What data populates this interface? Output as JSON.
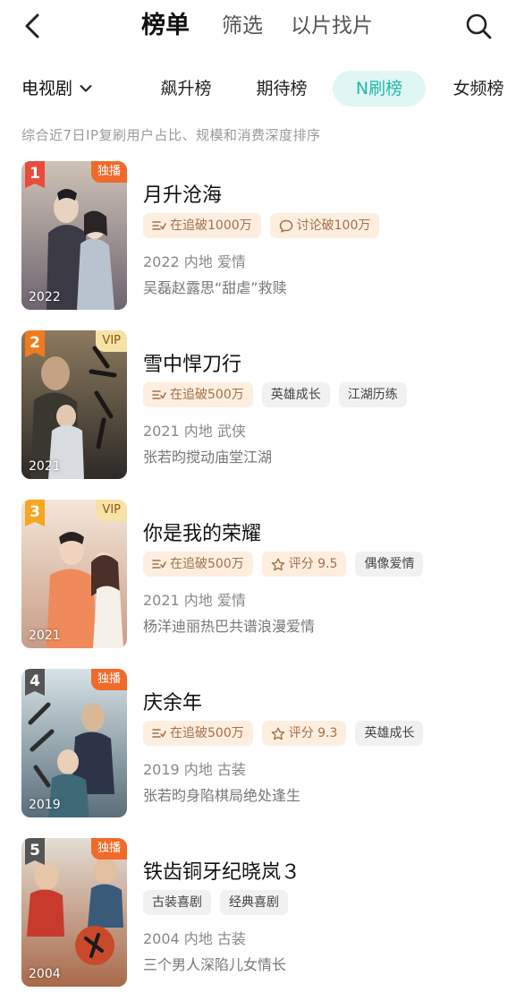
{
  "header": {
    "tabs": [
      {
        "label": "榜单",
        "active": true
      },
      {
        "label": "筛选",
        "active": false
      },
      {
        "label": "以片找片",
        "active": false
      }
    ]
  },
  "filter": {
    "genre": "电视剧",
    "subtabs": [
      {
        "label": "飙升榜",
        "active": false
      },
      {
        "label": "期待榜",
        "active": false
      },
      {
        "label": "N刷榜",
        "active": true
      },
      {
        "label": "女频榜",
        "active": false
      }
    ]
  },
  "description": "综合近7日IP复刷用户占比、规模和消费深度排序",
  "colors": {
    "accent": "#23b7ac",
    "accent_bg": "#dff6f4",
    "rank1": "#e94b3c",
    "rank2": "#f07b1f",
    "rank3": "#f5a623",
    "rank_other": "#555555",
    "exclusive": "#f06a2a",
    "vip": "#f6e2a6"
  },
  "items": [
    {
      "rank": "1",
      "corner": "独播",
      "corner_type": "exclusive",
      "year": "2022",
      "title": "月升沧海",
      "chips": [
        {
          "text": "在追破1000万",
          "type": "hot",
          "icon": "follow-icon"
        },
        {
          "text": "讨论破100万",
          "type": "hot",
          "icon": "comment-icon"
        }
      ],
      "meta": "2022 内地 爱情",
      "line2": "吴磊赵露思“甜虐”救赎"
    },
    {
      "rank": "2",
      "corner": "VIP",
      "corner_type": "vip",
      "year": "2021",
      "title": "雪中悍刀行",
      "chips": [
        {
          "text": "在追破500万",
          "type": "hot",
          "icon": "follow-icon"
        },
        {
          "text": "英雄成长",
          "type": "plain",
          "icon": ""
        },
        {
          "text": "江湖历练",
          "type": "plain",
          "icon": ""
        }
      ],
      "meta": "2021 内地 武侠",
      "line2": "张若昀搅动庙堂江湖"
    },
    {
      "rank": "3",
      "corner": "VIP",
      "corner_type": "vip",
      "year": "2021",
      "title": "你是我的荣耀",
      "chips": [
        {
          "text": "在追破500万",
          "type": "hot",
          "icon": "follow-icon"
        },
        {
          "text": "评分 9.5",
          "type": "hot",
          "icon": "star-icon"
        },
        {
          "text": "偶像爱情",
          "type": "plain",
          "icon": ""
        }
      ],
      "meta": "2021 内地 爱情",
      "line2": "杨洋迪丽热巴共谱浪漫爱情"
    },
    {
      "rank": "4",
      "corner": "独播",
      "corner_type": "exclusive",
      "year": "2019",
      "title": "庆余年",
      "chips": [
        {
          "text": "在追破500万",
          "type": "hot",
          "icon": "follow-icon"
        },
        {
          "text": "评分 9.3",
          "type": "hot",
          "icon": "star-icon"
        },
        {
          "text": "英雄成长",
          "type": "plain",
          "icon": ""
        }
      ],
      "meta": "2019 内地 古装",
      "line2": "张若昀身陷棋局绝处逢生"
    },
    {
      "rank": "5",
      "corner": "独播",
      "corner_type": "exclusive",
      "year": "2004",
      "title": "铁齿铜牙纪晓岚３",
      "chips": [
        {
          "text": "古装喜剧",
          "type": "plain",
          "icon": ""
        },
        {
          "text": "经典喜剧",
          "type": "plain",
          "icon": ""
        }
      ],
      "meta": "2004 内地 古装",
      "line2": "三个男人深陷儿女情长"
    }
  ]
}
